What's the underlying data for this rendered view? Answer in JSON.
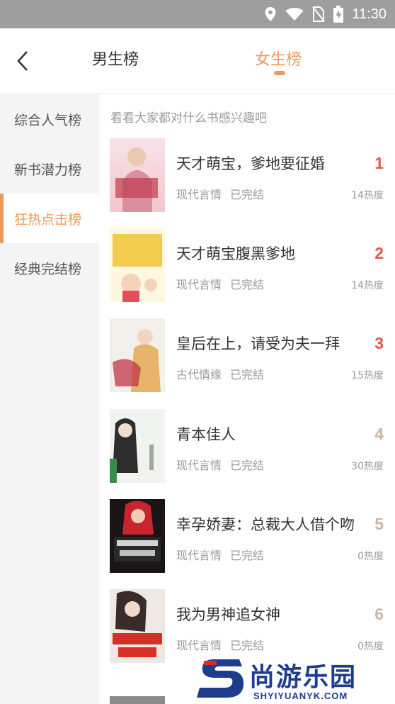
{
  "status_bar": {
    "time": "11:30"
  },
  "header": {
    "tabs": [
      {
        "label": "男生榜",
        "active": false
      },
      {
        "label": "女生榜",
        "active": true
      }
    ],
    "accent_color": "#f0985a"
  },
  "sidebar": {
    "items": [
      {
        "label": "综合人气榜",
        "active": false
      },
      {
        "label": "新书潜力榜",
        "active": false
      },
      {
        "label": "狂热点击榜",
        "active": true
      },
      {
        "label": "经典完结榜",
        "active": false
      }
    ]
  },
  "main": {
    "hint": "看看大家都对什么书感兴趣吧",
    "books": [
      {
        "title": "天才萌宝，爹地要征婚",
        "genre": "现代言情",
        "status": "已完结",
        "rank": "1",
        "heat": "14热度"
      },
      {
        "title": "天才萌宝腹黑爹地",
        "genre": "现代言情",
        "status": "已完结",
        "rank": "2",
        "heat": "14热度"
      },
      {
        "title": "皇后在上，请受为夫一拜",
        "genre": "古代情缘",
        "status": "已完结",
        "rank": "3",
        "heat": "15热度"
      },
      {
        "title": "青本佳人",
        "genre": "现代言情",
        "status": "已完结",
        "rank": "4",
        "heat": "30热度"
      },
      {
        "title": "幸孕娇妻：总裁大人借个吻",
        "genre": "现代言情",
        "status": "已完结",
        "rank": "5",
        "heat": "0热度"
      },
      {
        "title": "我为男神追女神",
        "genre": "现代言情",
        "status": "已完结",
        "rank": "6",
        "heat": "0热度"
      }
    ]
  },
  "watermark": {
    "text": "尚游乐园",
    "url": "SHYIYUANYK.COM"
  }
}
